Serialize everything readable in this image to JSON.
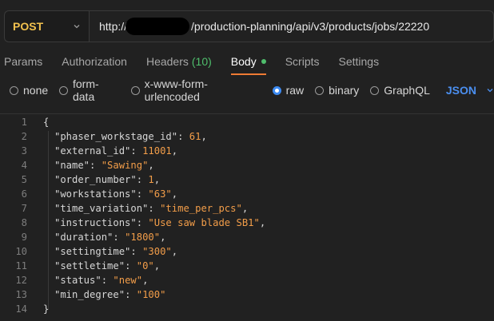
{
  "request": {
    "method": "POST",
    "url_prefix": "http://",
    "url_suffix": "/production-planning/api/v3/products/jobs/22220"
  },
  "tabs": [
    {
      "label": "Params"
    },
    {
      "label": "Authorization"
    },
    {
      "label": "Headers",
      "count": "(10)"
    },
    {
      "label": "Body"
    },
    {
      "label": "Scripts"
    },
    {
      "label": "Settings"
    }
  ],
  "body_options": {
    "items": [
      "none",
      "form-data",
      "x-www-form-urlencoded",
      "raw",
      "binary",
      "GraphQL"
    ],
    "selected": "raw",
    "format": "JSON"
  },
  "editor": {
    "lines": [
      {
        "n": "1",
        "text": "{"
      },
      {
        "n": "2",
        "key": "\"phaser_workstage_id\"",
        "value": "61",
        "type": "num"
      },
      {
        "n": "3",
        "key": "\"external_id\"",
        "value": "11001",
        "type": "num"
      },
      {
        "n": "4",
        "key": "\"name\"",
        "value": "\"Sawing\"",
        "type": "str"
      },
      {
        "n": "5",
        "key": "\"order_number\"",
        "value": "1",
        "type": "num"
      },
      {
        "n": "6",
        "key": "\"workstations\"",
        "value": "\"63\"",
        "type": "str"
      },
      {
        "n": "7",
        "key": "\"time_variation\"",
        "value": "\"time_per_pcs\"",
        "type": "str"
      },
      {
        "n": "8",
        "key": "\"instructions\"",
        "value": "\"Use saw blade SB1\"",
        "type": "str"
      },
      {
        "n": "9",
        "key": "\"duration\"",
        "value": "\"1800\"",
        "type": "str"
      },
      {
        "n": "10",
        "key": "\"settingtime\"",
        "value": "\"300\"",
        "type": "str"
      },
      {
        "n": "11",
        "key": "\"settletime\"",
        "value": "\"0\"",
        "type": "str"
      },
      {
        "n": "12",
        "key": "\"status\"",
        "value": "\"new\"",
        "type": "str"
      },
      {
        "n": "13",
        "key": "\"min_degree\"",
        "value": "\"100\"",
        "type": "str",
        "last": true
      },
      {
        "n": "14",
        "text": "}"
      }
    ]
  },
  "colors": {
    "method": "#f2c14e",
    "accent": "#4b8ff0",
    "value": "#f29d49",
    "active_underline": "#f07b34",
    "badge": "#4fbe6c"
  }
}
